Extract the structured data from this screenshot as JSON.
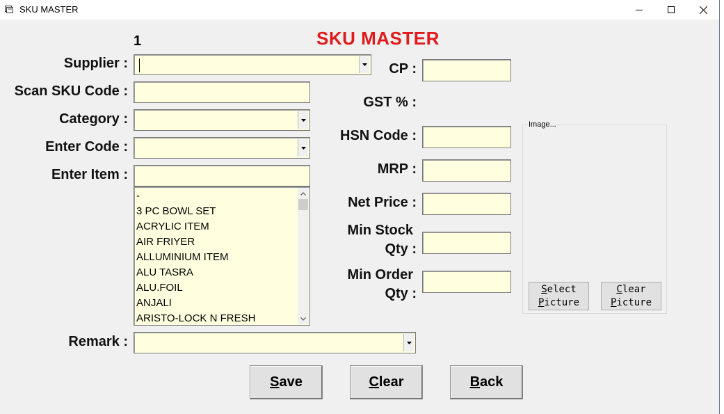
{
  "window": {
    "title": "SKU MASTER"
  },
  "form": {
    "title": "SKU MASTER",
    "counter": "1"
  },
  "labels": {
    "supplier": "Supplier :",
    "scan_sku": "Scan SKU Code :",
    "category": "Category :",
    "enter_code": "Enter Code :",
    "enter_item": "Enter Item :",
    "remark": "Remark :",
    "cp": "CP :",
    "gst": "GST % :",
    "hsn": "HSN Code :",
    "mrp": "MRP :",
    "net_price": "Net Price :",
    "min_stock_1": "Min Stock",
    "min_stock_2": "Qty :",
    "min_order_1": "Min Order",
    "min_order_2": "Qty :"
  },
  "item_list": [
    "-",
    "3 PC BOWL SET",
    "ACRYLIC ITEM",
    "AIR FRIYER",
    "ALLUMINIUM ITEM",
    "ALU TASRA",
    "ALU.FOIL",
    "ANJALI",
    "ARISTO-LOCK N FRESH"
  ],
  "image_group": {
    "title": "Image...",
    "select_line1": "Select",
    "select_line2": "Picture",
    "clear_line1": "Clear",
    "clear_line2": "Picture"
  },
  "buttons": {
    "save": "Save",
    "clear": "Clear",
    "back": "Back"
  },
  "colors": {
    "field_bg": "#ffffe0",
    "title_red": "#e01b1b",
    "window_bg": "#f0f0f0"
  },
  "icons": [
    "app-icon",
    "minimize-icon",
    "maximize-icon",
    "close-icon",
    "chevron-down-icon",
    "chevron-up-icon"
  ]
}
